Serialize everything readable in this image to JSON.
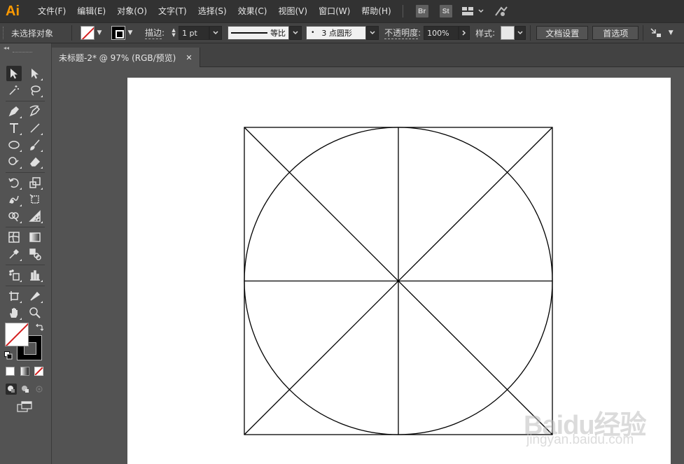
{
  "app": {
    "logo": "Ai"
  },
  "menubar": {
    "items": [
      "文件(F)",
      "编辑(E)",
      "对象(O)",
      "文字(T)",
      "选择(S)",
      "效果(C)",
      "视图(V)",
      "窗口(W)",
      "帮助(H)"
    ],
    "bridge": "Br",
    "stock": "St"
  },
  "controlbar": {
    "selection_state": "未选择对象",
    "stroke_label": "描边",
    "stroke_weight": "1 pt",
    "stroke_profile": "等比",
    "brush": "3 点圆形",
    "brush_dot": "•",
    "opacity_label": "不透明度",
    "opacity_value": "100%",
    "style_label": "样式",
    "doc_settings": "文档设置",
    "preferences": "首选项"
  },
  "tools_header": "◂◂",
  "document": {
    "tab_title": "未标题-2* @ 97% (RGB/预览)",
    "close_glyph": "✕"
  },
  "colors": {
    "logo": "#ff9a00",
    "none_slash": "#d41f1f",
    "artboard": "#ffffff",
    "artwork_stroke": "#000000"
  },
  "icons": [
    "selection-tool-icon",
    "direct-selection-tool-icon",
    "magic-wand-icon",
    "lasso-icon",
    "pen-tool-icon",
    "curvature-tool-icon",
    "type-tool-icon",
    "line-tool-icon",
    "ellipse-tool-icon",
    "paintbrush-icon",
    "shaper-tool-icon",
    "eraser-icon",
    "rotate-tool-icon",
    "scale-tool-icon",
    "warp-tool-icon",
    "free-transform-icon",
    "shape-builder-icon",
    "perspective-grid-icon",
    "mesh-tool-icon",
    "gradient-tool-icon",
    "eyedropper-icon",
    "blend-tool-icon",
    "symbol-sprayer-icon",
    "column-graph-icon",
    "artboard-tool-icon",
    "slice-tool-icon",
    "hand-tool-icon",
    "zoom-tool-icon",
    "swap-fill-stroke-icon",
    "default-colors-icon",
    "color-mode-icon",
    "gradient-mode-icon",
    "none-mode-icon",
    "draw-normal-icon",
    "draw-behind-icon",
    "draw-inside-icon",
    "screen-mode-icon"
  ],
  "watermark": {
    "brand": "Baidu经验",
    "url": "jingyan.baidu.com"
  }
}
